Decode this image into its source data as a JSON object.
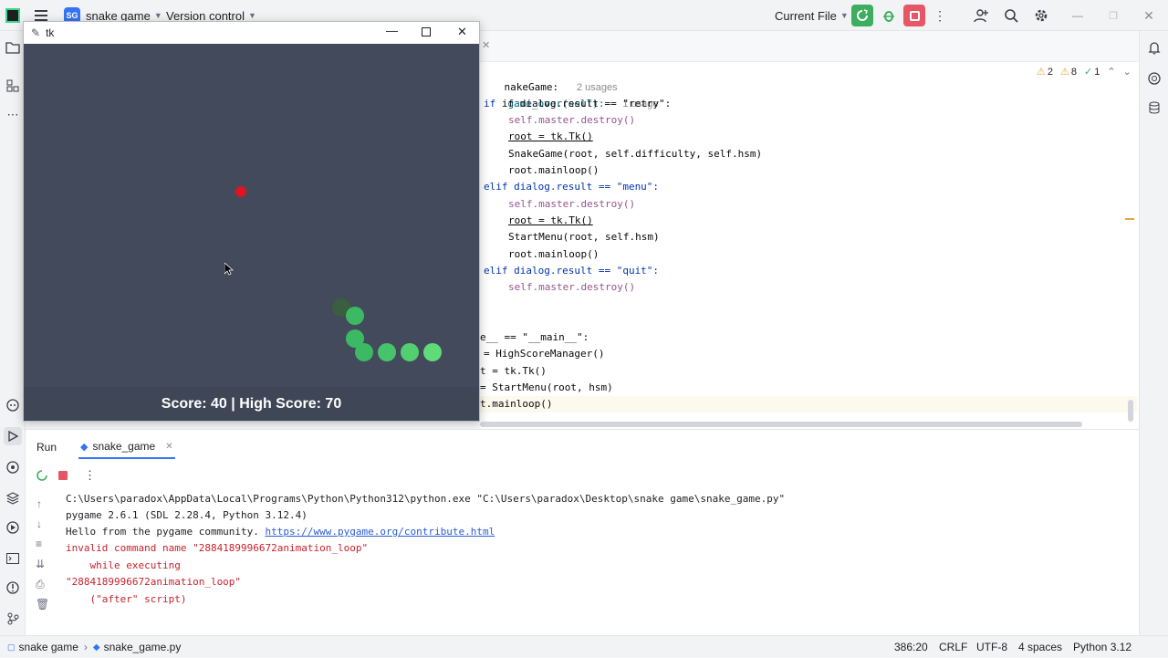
{
  "titlebar": {
    "project_badge": "SG",
    "project_name": "snake game",
    "vcs": "Version control",
    "run_config": "Current File"
  },
  "tk_window": {
    "title": "tk",
    "score_text": "Score: 40 | High Score: 70",
    "colors": {
      "background": "#434a5b",
      "food": "#e0141e",
      "snake_head": "#3a5f3e",
      "snake_body": "#3cb963",
      "snake_tail": "#5fdc78"
    }
  },
  "editor": {
    "breadcrumb_class": "nakeGame:",
    "breadcrumb_usages": "2 usages",
    "method_hint": "game_over(self):",
    "method_usages": "1 usage",
    "inspections": {
      "warnings": "2",
      "weak": "8",
      "ok": "1"
    },
    "lines": [
      "if dialog.result == \"retry\":",
      "self.master.destroy()",
      "root = tk.Tk()",
      "SnakeGame(root, self.difficulty, self.hsm)",
      "root.mainloop()",
      "elif dialog.result == \"menu\":",
      "self.master.destroy()",
      "root = tk.Tk()",
      "StartMenu(root, self.hsm)",
      "root.mainloop()",
      "elif dialog.result == \"quit\":",
      "self.master.destroy()",
      "e__ == \"__main__\":",
      "= HighScoreManager()",
      "t = tk.Tk()",
      "= StartMenu(root, hsm)",
      "t.mainloop()"
    ]
  },
  "run_panel": {
    "tab_run": "Run",
    "tab_config": "snake_game",
    "console": [
      {
        "text": "C:\\Users\\paradox\\AppData\\Local\\Programs\\Python\\Python312\\python.exe \"C:\\Users\\paradox\\Desktop\\snake game\\snake_game.py\"",
        "type": "normal"
      },
      {
        "text": "pygame 2.6.1 (SDL 2.28.4, Python 3.12.4)",
        "type": "normal"
      },
      {
        "text": "Hello from the pygame community. ",
        "type": "normal",
        "link": "https://www.pygame.org/contribute.html"
      },
      {
        "text": "invalid command name \"2884189996672animation_loop\"",
        "type": "error"
      },
      {
        "text": "    while executing",
        "type": "error"
      },
      {
        "text": "\"2884189996672animation_loop\"",
        "type": "error"
      },
      {
        "text": "    (\"after\" script)",
        "type": "error"
      }
    ]
  },
  "statusbar": {
    "project": "snake game",
    "file": "snake_game.py",
    "position": "386:20",
    "line_sep": "CRLF",
    "encoding": "UTF-8",
    "indent": "4 spaces",
    "interpreter": "Python 3.12"
  }
}
